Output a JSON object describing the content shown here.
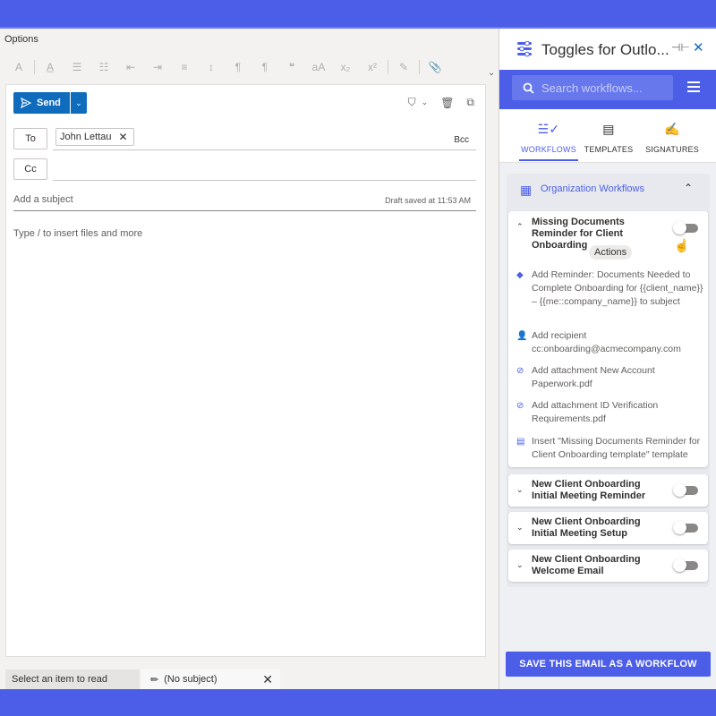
{
  "outlook": {
    "options_tab": "Options",
    "send_label": "Send",
    "to_label": "To",
    "cc_label": "Cc",
    "bcc_label": "Bcc",
    "recipient": "John Lettau",
    "subject_placeholder": "Add a subject",
    "draft_status": "Draft saved at 11:53 AM",
    "body_placeholder": "Type / to insert files and more",
    "status_text": "Select an item to read",
    "draft_tab": "(No subject)"
  },
  "addin": {
    "title": "Toggles for Outlo...",
    "search_placeholder": "Search workflows...",
    "tabs": [
      {
        "label": "WORKFLOWS",
        "active": true
      },
      {
        "label": "TEMPLATES",
        "active": false
      },
      {
        "label": "SIGNATURES",
        "active": false
      }
    ],
    "section_title": "Organization Workflows",
    "expanded_workflow": {
      "name": "Missing Documents Reminder for Client Onboarding",
      "enabled": false,
      "actions_label": "Actions",
      "actions": [
        {
          "icon": "tag-icon",
          "text": "Add Reminder: Documents Needed to Complete Onboarding for {{client_name}} – {{me::company_name}} to subject"
        },
        {
          "icon": "add-person-icon",
          "text": "Add recipient cc:onboarding@acmecompany.com"
        },
        {
          "icon": "paperclip-icon",
          "text": "Add attachment New Account Paperwork.pdf"
        },
        {
          "icon": "paperclip-icon",
          "text": "Add attachment ID Verification Requirements.pdf"
        },
        {
          "icon": "document-icon",
          "text": "Insert \"Missing Documents Reminder for Client Onboarding template\" template"
        }
      ]
    },
    "workflows": [
      {
        "name": "New Client Onboarding Initial Meeting Reminder",
        "enabled": false
      },
      {
        "name": "New Client Onboarding Initial Meeting Setup",
        "enabled": false
      },
      {
        "name": "New Client Onboarding Welcome Email",
        "enabled": false
      }
    ],
    "save_button": "SAVE THIS EMAIL AS A WORKFLOW"
  },
  "colors": {
    "brand": "#4c5ee8",
    "outlook_blue": "#0f6cbd"
  }
}
